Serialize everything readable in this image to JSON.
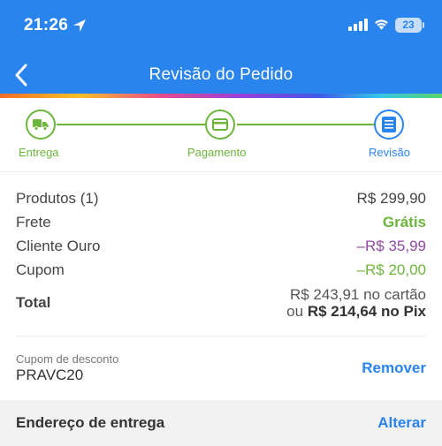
{
  "status_bar": {
    "time": "21:26",
    "battery": "23"
  },
  "header": {
    "title": "Revisão do Pedido",
    "back_icon": "chevron-left-icon",
    "background_color": "#2a84ee"
  },
  "stepper": {
    "steps": [
      {
        "label": "Entrega",
        "icon": "truck-icon",
        "state": "done"
      },
      {
        "label": "Pagamento",
        "icon": "credit-card-icon",
        "state": "done"
      },
      {
        "label": "Revisão",
        "icon": "list-icon",
        "state": "active"
      }
    ],
    "done_color": "#6cb63c",
    "active_color": "#2a84ee"
  },
  "summary": {
    "products_label": "Produtos (1)",
    "products_value": "R$ 299,90",
    "shipping_label": "Frete",
    "shipping_value": "Grátis",
    "gold_label": "Cliente Ouro",
    "gold_value": "–R$ 35,99",
    "coupon_label": "Cupom",
    "coupon_value": "–R$ 20,00",
    "total_label": "Total",
    "total_card": "R$ 243,91 no cartão",
    "total_pix_prefix": "ou",
    "total_pix": "R$ 214,64 no Pix"
  },
  "coupon": {
    "caption": "Cupom de desconto",
    "code": "PRAVC20",
    "remove_label": "Remover"
  },
  "address": {
    "title": "Endereço de entrega",
    "change_label": "Alterar"
  }
}
